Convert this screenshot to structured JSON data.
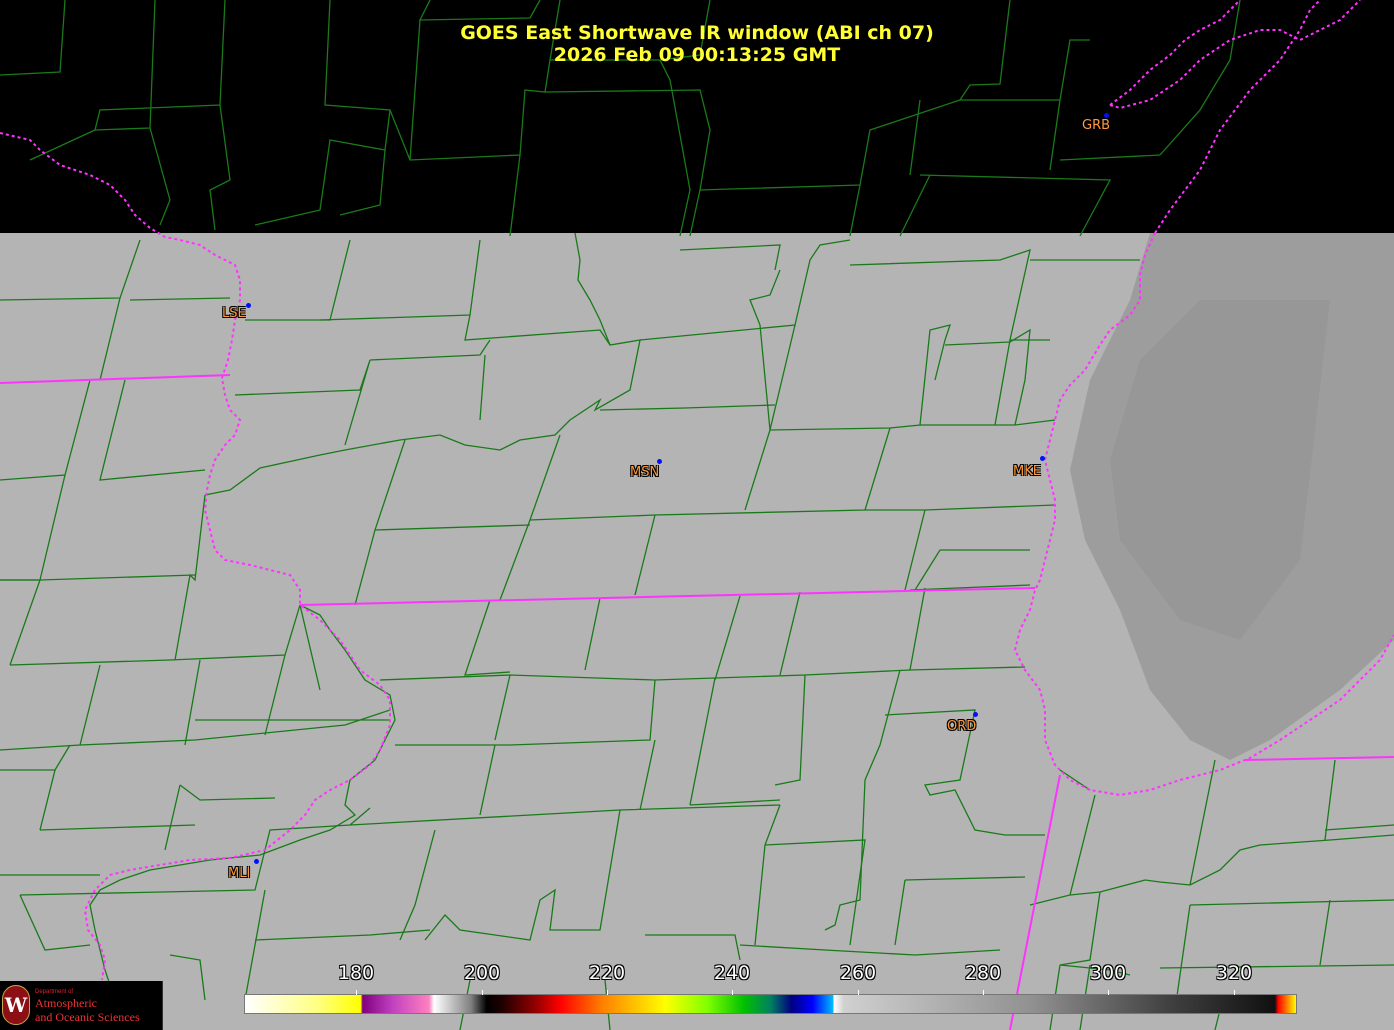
{
  "title": {
    "line1": "GOES East Shortwave IR window (ABI ch 07)",
    "line2": "2026 Feb 09  00:13:25 GMT"
  },
  "stations": [
    {
      "code": "GRB"
    },
    {
      "code": "LSE"
    },
    {
      "code": "MSN"
    },
    {
      "code": "MKE"
    },
    {
      "code": "ORD"
    },
    {
      "code": "MLI"
    }
  ],
  "colorbar": {
    "unit_values": [
      "180",
      "200",
      "220",
      "240",
      "260",
      "280",
      "300",
      "320"
    ],
    "range_min": 163,
    "range_max": 330
  },
  "logo": {
    "dept": "Department of",
    "line1": "Atmospheric",
    "line2": "and Oceanic Sciences",
    "seal_letter": "W"
  },
  "colors": {
    "title": "#ffff33",
    "county_lines": "#1a7a1a",
    "state_lines": "#ff33ff",
    "station_label": "#ff9a3c",
    "station_dot": "#0010ff",
    "land_gray": "#b3b3b3",
    "lake_gray": "#999999"
  },
  "icons": [
    "uw-seal-icon",
    "station-dot-icon"
  ]
}
